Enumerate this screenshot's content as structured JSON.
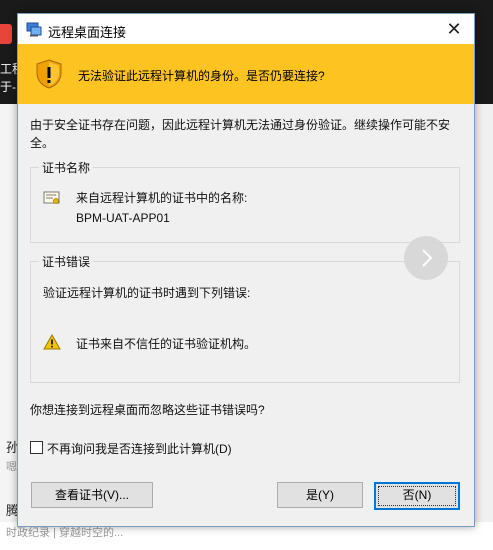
{
  "background": {
    "left_text_1": "工程",
    "left_text_2": "于-",
    "side_text_1": "孙",
    "side_muted_1": "嗯",
    "side_text_2": "腾",
    "bottom_text": "时政纪录 | 穿越时空的..."
  },
  "dialog": {
    "title": "远程桌面连接",
    "close_symbol": "✕",
    "banner_text": "无法验证此远程计算机的身份。是否仍要连接?",
    "description": "由于安全证书存在问题，因此远程计算机无法通过身份验证。继续操作可能不安全。",
    "cert_name_group": {
      "label": "证书名称",
      "name_label": "来自远程计算机的证书中的名称:",
      "name_value": "BPM-UAT-APP01"
    },
    "cert_error_group": {
      "label": "证书错误",
      "intro": "验证远程计算机的证书时遇到下列错误:",
      "error_item": "证书来自不信任的证书验证机构。"
    },
    "question": "你想连接到远程桌面而忽略这些证书错误吗?",
    "checkbox_label": "不再询问我是否连接到此计算机(D)",
    "checkbox_checked": false,
    "buttons": {
      "view_cert": "查看证书(V)...",
      "yes": "是(Y)",
      "no": "否(N)"
    }
  },
  "colors": {
    "banner": "#fcc321",
    "focus_border": "#0078d7",
    "dialog_bg": "#f0f0f0"
  }
}
